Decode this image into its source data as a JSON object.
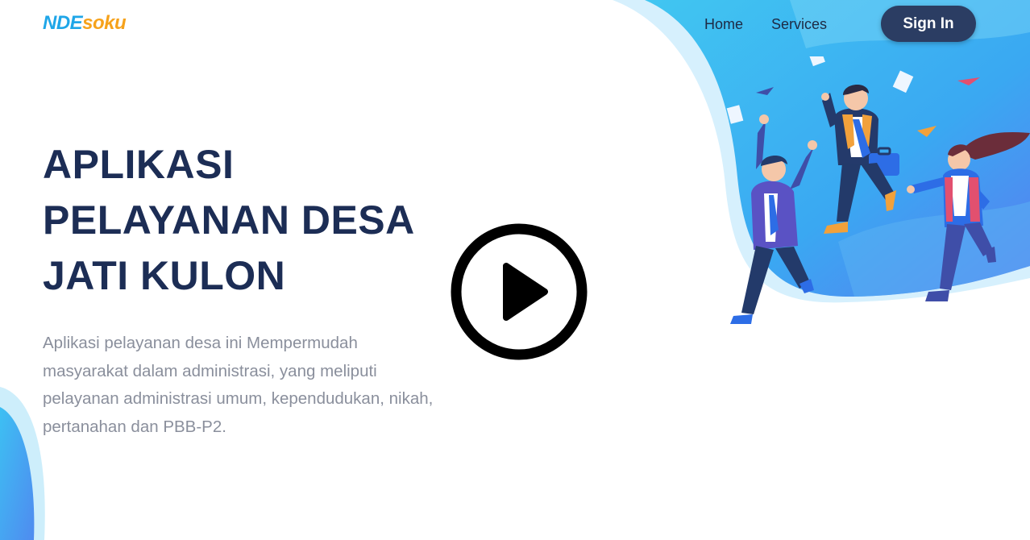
{
  "brand": {
    "logo_part1": "NDE",
    "logo_part2": "soku",
    "colors": {
      "logo_primary": "#1fa6e8",
      "logo_accent": "#f6a21b",
      "heading": "#1c2d55",
      "button": "#2b3d63",
      "body_text": "#8a8f9c",
      "hero_blue": "#3fb8ee"
    }
  },
  "nav": {
    "links": [
      {
        "label": "Home"
      },
      {
        "label": "Services"
      }
    ],
    "signin_label": "Sign In"
  },
  "hero": {
    "title_lines": [
      "APLIKASI",
      "PELAYANAN DESA",
      "JATI KULON"
    ],
    "description_lines": [
      "Aplikasi pelayanan desa ini Mempermudah",
      "masyarakat dalam administrasi, yang meliputi",
      "pelayanan administrasi umum, kependudukan, nikah,",
      "pertanahan dan PBB-P2."
    ]
  },
  "video": {
    "play_icon": "play-icon"
  },
  "illustration": {
    "icon": "business-people-celebrating-illustration"
  }
}
